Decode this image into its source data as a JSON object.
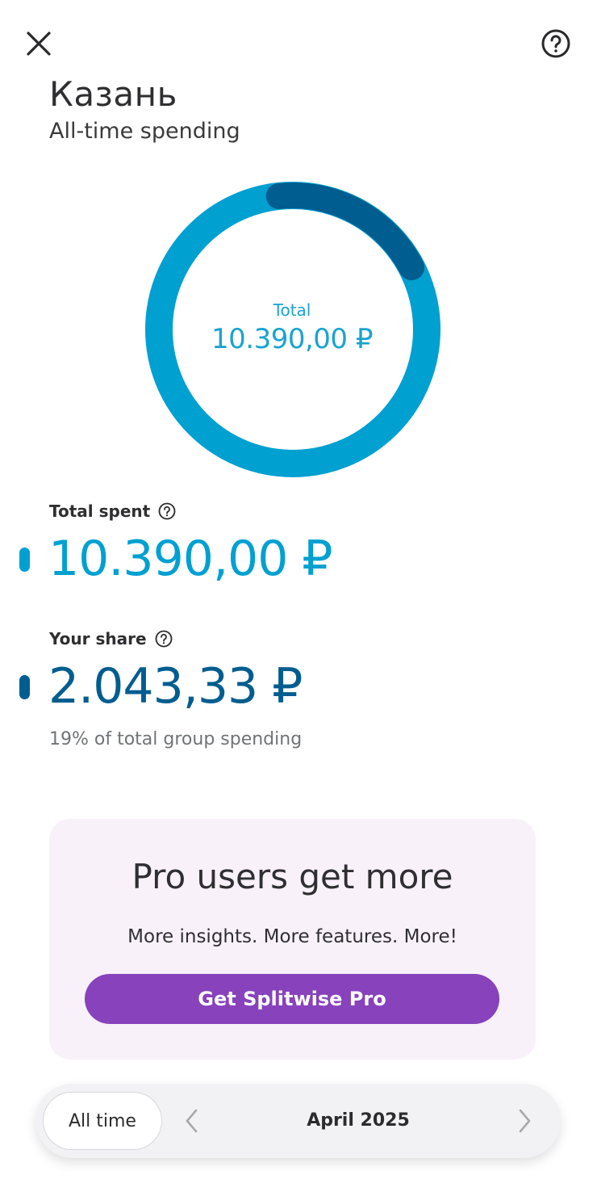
{
  "header": {
    "close_icon": "close-icon",
    "help_icon": "help-circle-icon"
  },
  "group": {
    "title": "Казань",
    "subtitle": "All-time spending"
  },
  "donut": {
    "center_label": "Total",
    "center_value": "10.390,00 ₽",
    "share_fraction": 0.19,
    "colors": {
      "total": "#00a0d1",
      "share": "#005d8f"
    }
  },
  "stats": {
    "total_spent": {
      "label": "Total spent",
      "value": "10.390,00 ₽",
      "color": "#00a0d1"
    },
    "your_share": {
      "label": "Your share",
      "value": "2.043,33 ₽",
      "color": "#005d8f",
      "note": "19% of total group spending"
    }
  },
  "promo": {
    "title": "Pro users get more",
    "subtitle": "More insights. More features. More!",
    "button_label": "Get Splitwise Pro",
    "button_color": "#8742bc"
  },
  "period": {
    "all_time_label": "All time",
    "current_label": "April 2025",
    "prev_icon": "chevron-left-icon",
    "next_icon": "chevron-right-icon"
  }
}
